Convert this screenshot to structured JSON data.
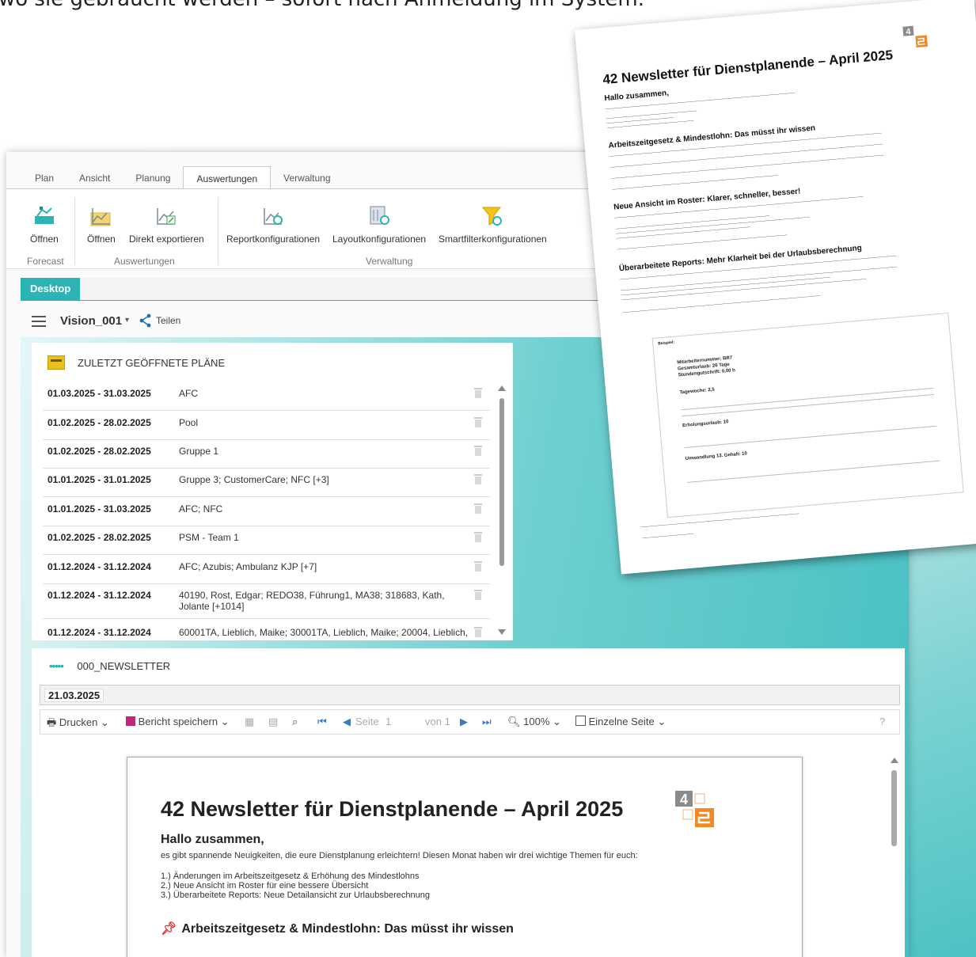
{
  "top_caption": "wo sie gebraucht werden – sofort nach Anmeldung im System.",
  "ribbon": {
    "tabs": [
      {
        "label": "Plan"
      },
      {
        "label": "Ansicht"
      },
      {
        "label": "Planung"
      },
      {
        "label": "Auswertungen"
      },
      {
        "label": "Verwaltung"
      }
    ],
    "active_tab": "Auswertungen",
    "buttons": {
      "forecast_open": "Öffnen",
      "reports_open": "Öffnen",
      "export": "Direkt exportieren",
      "report_config": "Reportkonfigurationen",
      "layout_config": "Layoutkonfigurationen",
      "smartfilter_config": "Smartfilterkonfigurationen"
    },
    "groups": {
      "forecast": "Forecast",
      "evaluations": "Auswertungen",
      "admin": "Verwaltung"
    }
  },
  "desktop_tab": "Desktop",
  "vision": {
    "title": "Vision_001",
    "caret": "▾",
    "share": "Teilen"
  },
  "recent_plans": {
    "title": "ZULETZT GEÖFFNETE PLÄNE",
    "rows": [
      {
        "date": "01.03.2025 - 31.03.2025",
        "name": "AFC"
      },
      {
        "date": "01.02.2025 - 28.02.2025",
        "name": "Pool"
      },
      {
        "date": "01.02.2025 - 28.02.2025",
        "name": "Gruppe 1"
      },
      {
        "date": "01.01.2025 - 31.01.2025",
        "name": "Gruppe 3; CustomerCare; NFC [+3]"
      },
      {
        "date": "01.01.2025 - 31.03.2025",
        "name": "AFC; NFC"
      },
      {
        "date": "01.02.2025 - 28.02.2025",
        "name": "PSM - Team 1"
      },
      {
        "date": "01.12.2024 - 31.12.2024",
        "name": "AFC; Azubis; Ambulanz KJP [+7]"
      },
      {
        "date": "01.12.2024 - 31.12.2024",
        "name": "40190, Rost, Edgar; REDO38, Führung1, MA38; 318683, Kath, Jolante [+1014]"
      },
      {
        "date": "01.12.2024 - 31.12.2024",
        "name": "60001TA, Lieblich, Maike; 30001TA, Lieblich, Maike; 20004, Lieblich,"
      }
    ]
  },
  "newsletter_panel": {
    "title": "000_NEWSLETTER",
    "date": "21.03.2025",
    "toolbar": {
      "print": "Drucken",
      "save": "Bericht speichern",
      "page_label": "Seite",
      "page_value": "1",
      "of_label": "von 1",
      "zoom": "100%",
      "single_page": "Einzelne Seite",
      "help": "?"
    }
  },
  "document": {
    "title": "42 Newsletter für Dienstplanende – April 2025",
    "greeting": "Hallo zusammen,",
    "intro": "es gibt spannende Neuigkeiten, die eure Dienstplanung erleichtern! Diesen Monat haben wir drei wichtige Themen für euch:",
    "list": [
      "1.) Änderungen im Arbeitszeitgesetz & Erhöhung des Mindestlohns",
      "2.) Neue Ansicht im Roster für eine bessere Übersicht",
      "3.) Überarbeitete Reports: Neue Detailansicht zur Urlaubsberechnung"
    ],
    "section1": "Arbeitszeitgesetz & Mindestlohn: Das müsst ihr wissen",
    "logo_text": "4"
  },
  "paper": {
    "title": "42 Newsletter für Dienstplanende – April 2025",
    "greeting": "Hallo zusammen,",
    "section1": "Arbeitszeitgesetz & Mindestlohn: Das müsst ihr wissen",
    "section2": "Neue Ansicht im Roster: Klarer, schneller, besser!",
    "section3": "Überarbeitete Reports: Mehr Klarheit bei der Urlaubsberechnung",
    "box": {
      "label": "Beispiel:",
      "employee": "Mitarbeiternummer: BR7",
      "leave_total": "Gesamturlaub: 26 Tage",
      "hours_credit": "Stundengutschrift: 0,00 h",
      "week": "Tagewoche: 2,5",
      "recovery": "Erholungsurlaub: 10",
      "conversion": "Umwandlung 13. Gehalt: 10"
    }
  },
  "colors": {
    "accent": "#2bb3b5",
    "logo_orange": "#f08a24",
    "logo_grey": "#8a8a8a"
  }
}
